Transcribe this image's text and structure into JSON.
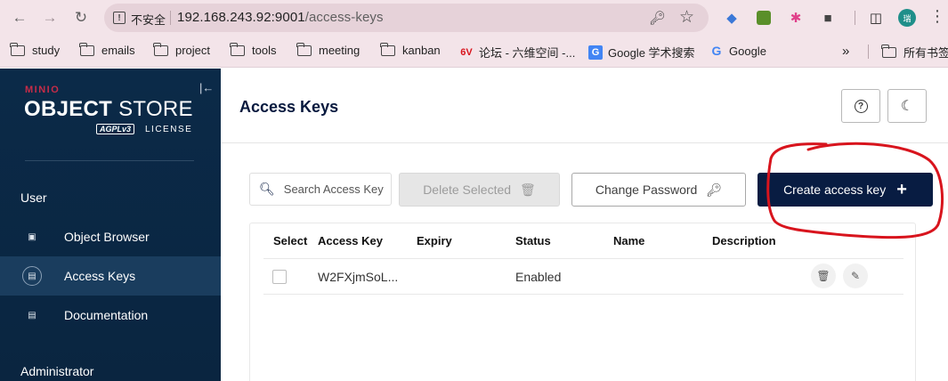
{
  "browser": {
    "insecure_label": "不安全",
    "url_host": "192.168.243.92:9001",
    "url_path": "/access-keys",
    "bookmarks": [
      {
        "label": "study",
        "type": "folder"
      },
      {
        "label": "emails",
        "type": "folder"
      },
      {
        "label": "project",
        "type": "folder"
      },
      {
        "label": "tools",
        "type": "folder"
      },
      {
        "label": "meeting",
        "type": "folder"
      },
      {
        "label": "kanban",
        "type": "folder"
      },
      {
        "label": "论坛 - 六维空间 -...",
        "type": "site"
      },
      {
        "label": "Google 学术搜索",
        "type": "site"
      },
      {
        "label": "Google",
        "type": "site"
      }
    ],
    "more_bookmarks": "»",
    "all_bookmarks": "所有书签",
    "profile_initial": "瑞"
  },
  "sidebar": {
    "logo_brand": "MINIO",
    "logo_object": "OBJECT",
    "logo_store": " STORE",
    "logo_agpl": "AGPLv3",
    "logo_license": "LICENSE",
    "section_user": "User",
    "items": [
      {
        "label": "Object Browser",
        "icon": "bucket-icon"
      },
      {
        "label": "Access Keys",
        "icon": "key-card-icon",
        "active": true
      },
      {
        "label": "Documentation",
        "icon": "docs-icon"
      }
    ],
    "section_admin": "Administrator"
  },
  "main": {
    "title": "Access Keys",
    "search_placeholder": "Search Access Keys",
    "delete_label": "Delete Selected",
    "change_password_label": "Change Password",
    "create_label": "Create access key",
    "table": {
      "headers": [
        "Select",
        "Access Key",
        "Expiry",
        "Status",
        "Name",
        "Description"
      ],
      "rows": [
        {
          "access_key": "W2FXjmSoL...",
          "expiry": "",
          "status": "Enabled",
          "name": "",
          "description": ""
        }
      ]
    }
  },
  "colors": {
    "sidebar_bg": "#0b2a48",
    "primary": "#081c42",
    "annotation": "#d8141d"
  }
}
